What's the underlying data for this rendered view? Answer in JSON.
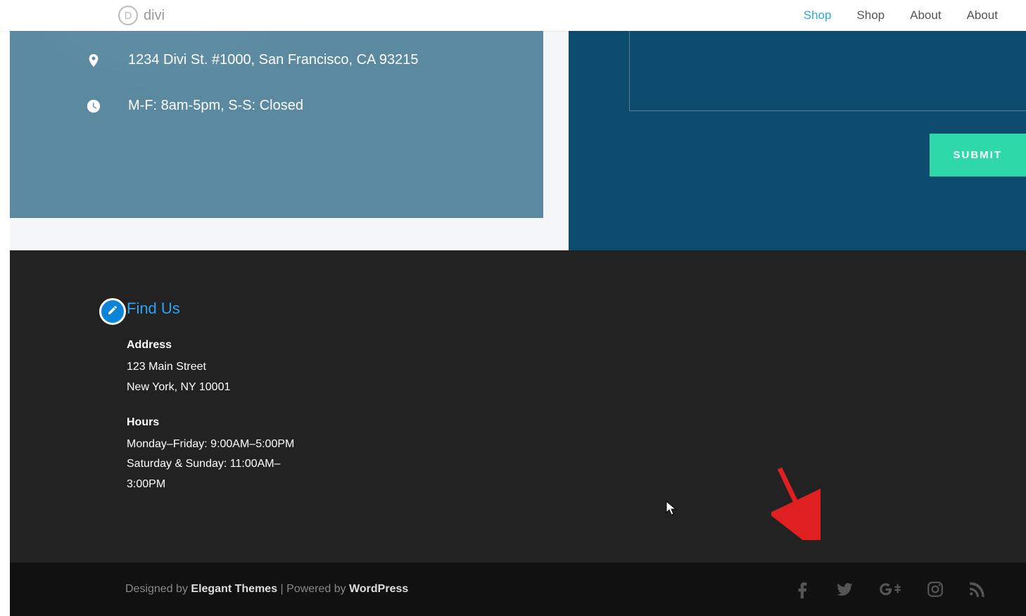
{
  "header": {
    "logo_letter": "D",
    "logo_text": "divi",
    "nav": [
      {
        "label": "Shop",
        "active": true
      },
      {
        "label": "Shop",
        "active": false
      },
      {
        "label": "About",
        "active": false
      },
      {
        "label": "About",
        "active": false
      }
    ]
  },
  "contact_panel": {
    "address": "1234 Divi St. #1000, San Francisco, CA 93215",
    "hours": "M-F: 8am-5pm, S-S: Closed"
  },
  "form": {
    "submit_label": "SUBMIT"
  },
  "footer": {
    "title": "Find Us",
    "address_label": "Address",
    "address_line1": "123 Main Street",
    "address_line2": "New York, NY 10001",
    "hours_label": "Hours",
    "hours_line1": "Monday–Friday: 9:00AM–5:00PM",
    "hours_line2": "Saturday & Sunday: 11:00AM–3:00PM"
  },
  "bottom": {
    "designed_prefix": "Designed by ",
    "designed_name": "Elegant Themes",
    "sep": " | ",
    "powered_prefix": "Powered by ",
    "powered_name": "WordPress"
  }
}
